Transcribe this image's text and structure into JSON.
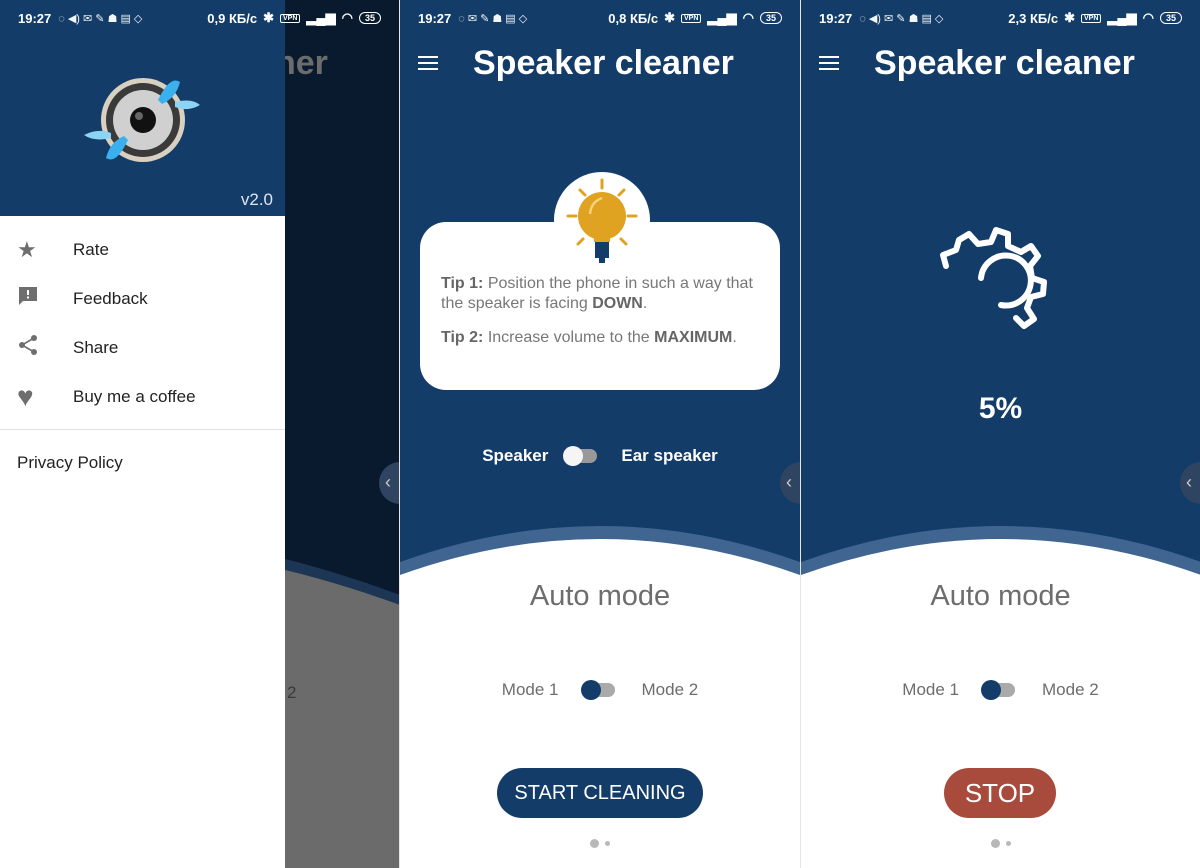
{
  "colors": {
    "primary": "#133c69",
    "stop": "#a84a3c",
    "bulb": "#e0a321",
    "white": "#ffffff"
  },
  "app": {
    "title": "Speaker cleaner",
    "title_fragment": "ner",
    "version": "v2.0"
  },
  "screens": [
    {
      "status": {
        "time": "19:27",
        "speed": "0,9 КБ/с",
        "vpn": "VPN",
        "battery": "35"
      }
    },
    {
      "status": {
        "time": "19:27",
        "speed": "0,8 КБ/с",
        "vpn": "VPN",
        "battery": "35"
      }
    },
    {
      "status": {
        "time": "19:27",
        "speed": "2,3 КБ/с",
        "vpn": "VPN",
        "battery": "35"
      }
    }
  ],
  "drawer": {
    "items": [
      {
        "label": "Rate",
        "icon": "star-icon"
      },
      {
        "label": "Feedback",
        "icon": "feedback-icon"
      },
      {
        "label": "Share",
        "icon": "share-icon"
      },
      {
        "label": "Buy me a coffee",
        "icon": "heart-icon"
      }
    ],
    "privacy": "Privacy Policy",
    "behind_mode_fragment": "2"
  },
  "tips": {
    "tip1_label": "Tip 1:",
    "tip1_text": " Position the phone in such a way that the speaker is facing ",
    "tip1_bold": "DOWN",
    "tip1_end": ".",
    "tip2_label": "Tip 2:",
    "tip2_text": " Increase volume to the ",
    "tip2_bold": "MAXIMUM",
    "tip2_end": "."
  },
  "output": {
    "left": "Speaker",
    "right": "Ear speaker",
    "selected": "Speaker"
  },
  "progress": {
    "label": "5%",
    "value_percent": 5
  },
  "mode": {
    "title": "Auto mode",
    "left": "Mode 1",
    "right": "Mode 2",
    "selected": "Mode 1"
  },
  "buttons": {
    "start": "START CLEANING",
    "stop": "STOP"
  },
  "pager": {
    "pages": 2,
    "current": 1
  }
}
